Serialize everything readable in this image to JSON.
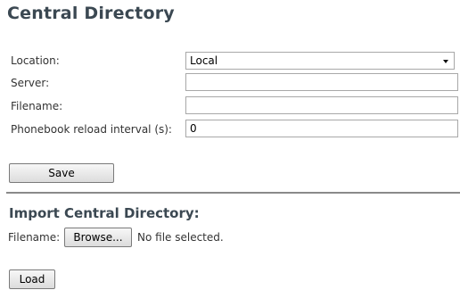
{
  "page": {
    "title": "Central Directory"
  },
  "form": {
    "location_label": "Location:",
    "location_value": "Local",
    "server_label": "Server:",
    "server_value": "",
    "filename_label": "Filename:",
    "filename_value": "",
    "reload_label": "Phonebook reload interval (s):",
    "reload_value": "0",
    "save_label": "Save"
  },
  "import": {
    "title": "Import Central Directory:",
    "filename_label": "Filename:",
    "browse_label": "Browse...",
    "file_status": "No file selected.",
    "load_label": "Load"
  }
}
